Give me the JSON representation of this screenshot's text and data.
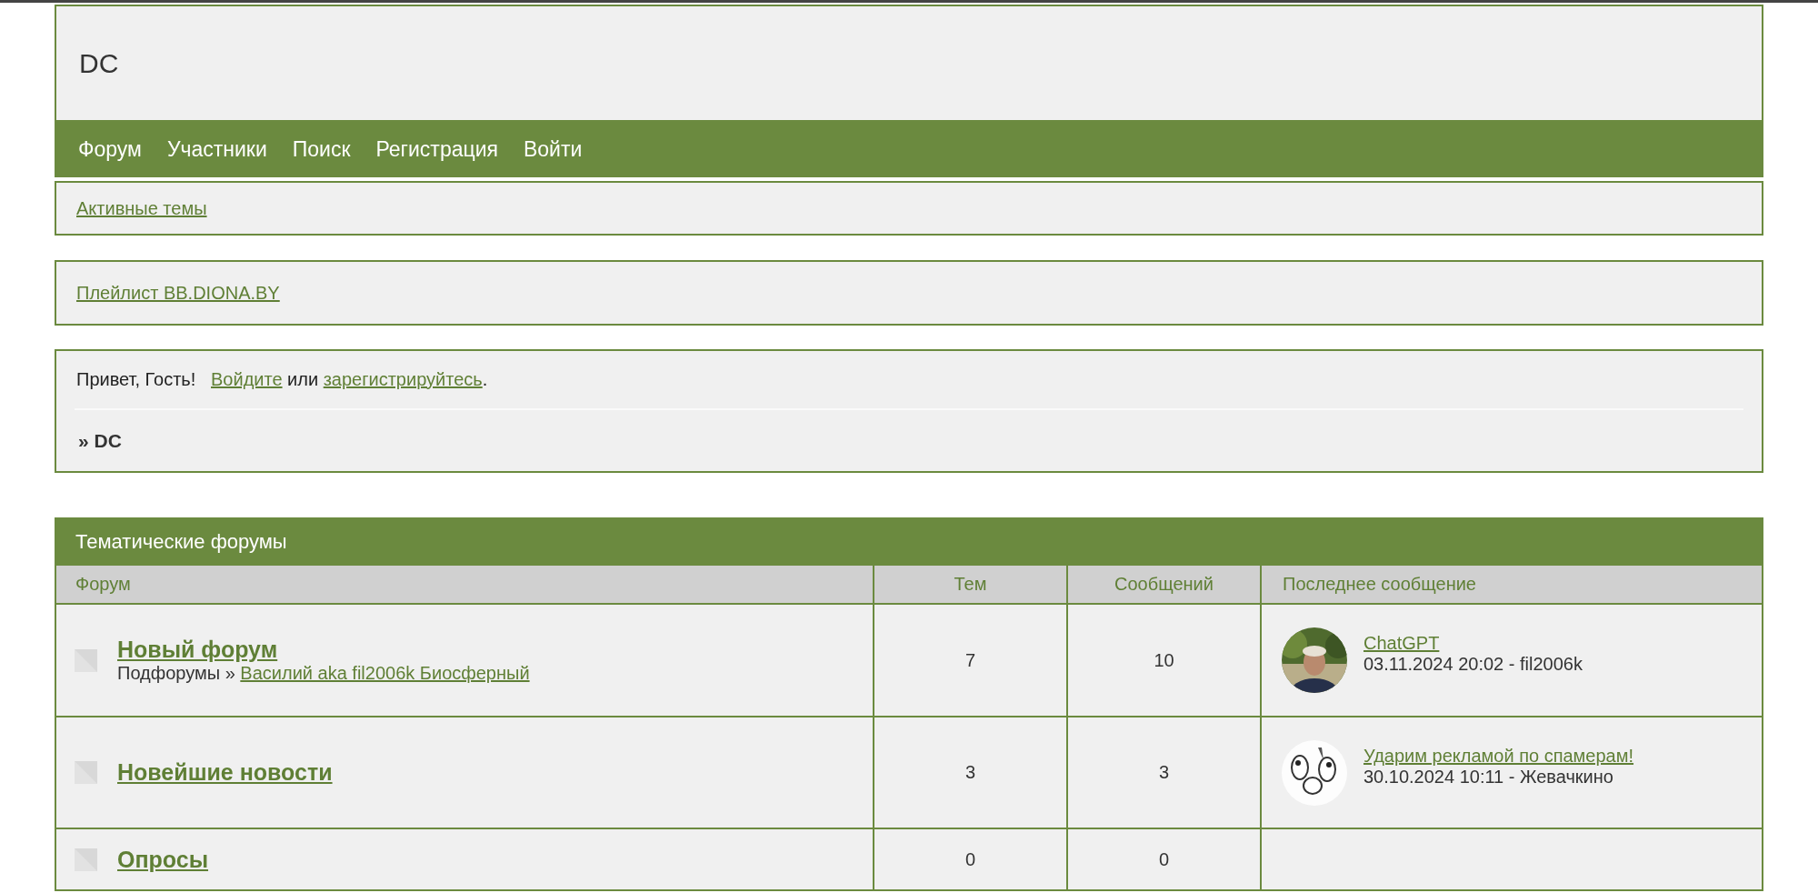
{
  "site": {
    "title": "DC"
  },
  "nav": [
    {
      "label": "Форум"
    },
    {
      "label": "Участники"
    },
    {
      "label": "Поиск"
    },
    {
      "label": "Регистрация"
    },
    {
      "label": "Войти"
    }
  ],
  "active_topics_link": "Активные темы",
  "playlist_link": "Плейлист BB.DIONA.BY",
  "greeting": {
    "text": "Привет, Гость!",
    "login_link": "Войдите",
    "joiner": "или",
    "register_link": "зарегистрируйтесь",
    "end": "."
  },
  "breadcrumb": "» DC",
  "category": {
    "title": "Тематические форумы",
    "columns": [
      "Форум",
      "Тем",
      "Сообщений",
      "Последнее сообщение"
    ],
    "forums": [
      {
        "name": "Новый форум",
        "subforums_label": "Подфорумы »",
        "subforum_link": "Василий aka fil2006k Биосферный",
        "topics": "7",
        "posts": "10",
        "last_post": {
          "title": "ChatGPT",
          "meta": "03.11.2024 20:02 - fil2006k"
        }
      },
      {
        "name": "Новейшие новости",
        "topics": "3",
        "posts": "3",
        "last_post": {
          "title": "Ударим рекламой по спамерам!",
          "meta": "30.10.2024 10:11 - Жевачкино"
        }
      },
      {
        "name": "Опросы",
        "topics": "0",
        "posts": "0"
      }
    ]
  }
}
